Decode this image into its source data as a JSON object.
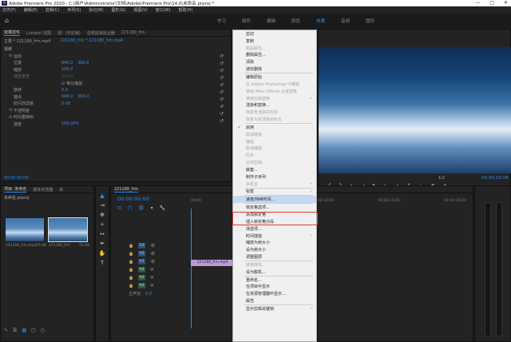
{
  "window": {
    "app_logo": "Pr",
    "title": "Adobe Premiere Pro 2020 - C:\\用户\\Administrator\\文档\\Adobe\\Premiere Pro\\14.0\\未命名.prproj *",
    "controls": [
      "—",
      "□",
      "✕"
    ]
  },
  "menubar": [
    "文件(F)",
    "编辑(E)",
    "剪辑(C)",
    "序列(S)",
    "标记(M)",
    "图形(G)",
    "视图(V)",
    "窗口(W)",
    "帮助(H)"
  ],
  "workspace_tabs": [
    {
      "label": "学习",
      "active": false
    },
    {
      "label": "组件",
      "active": false
    },
    {
      "label": "编辑",
      "active": false
    },
    {
      "label": "颜色",
      "active": false
    },
    {
      "label": "效果",
      "active": true
    },
    {
      "label": "音频",
      "active": false
    },
    {
      "label": "图形",
      "active": false
    }
  ],
  "effect_controls": {
    "tabs": [
      {
        "label": "效果控件",
        "active": true
      },
      {
        "label": "Lumetri 范围",
        "active": false
      },
      {
        "label": "源：(无剪辑)",
        "active": false
      },
      {
        "label": "音频剪辑混合器",
        "active": false
      },
      {
        "label": "221180_frin",
        "active": false
      }
    ],
    "source": "主要 * 221180_frin.mp4",
    "clip_ref": "221180_frin * 221180_frin.mp4",
    "section": "视频",
    "rows": [
      {
        "tri": "›",
        "fx": "fx",
        "name": "运动",
        "v1": "",
        "v2": ""
      },
      {
        "tri": "›",
        "fx": "",
        "name": "位置",
        "v1": "640.0",
        "v2": "360.0"
      },
      {
        "tri": "›",
        "fx": "",
        "name": "缩放",
        "v1": "100.0",
        "v2": ""
      },
      {
        "tri": "›",
        "fx": "",
        "name": "缩放宽度",
        "v1": "100.0",
        "v2": ""
      },
      {
        "tri": "",
        "fx": "",
        "name": "",
        "v1": "☑ 等比缩放",
        "v2": ""
      },
      {
        "tri": "›",
        "fx": "",
        "name": "旋转",
        "v1": "0.0",
        "v2": ""
      },
      {
        "tri": "",
        "fx": "",
        "name": "锚点",
        "v1": "640.0",
        "v2": "360.0"
      },
      {
        "tri": "›",
        "fx": "",
        "name": "防闪烁滤镜",
        "v1": "0.00",
        "v2": ""
      },
      {
        "tri": "›",
        "fx": "fx",
        "name": "不透明度",
        "v1": "",
        "v2": ""
      },
      {
        "tri": "›",
        "fx": "fx",
        "name": "时间重映射",
        "v1": "",
        "v2": ""
      },
      {
        "tri": "›",
        "fx": "",
        "name": "速度",
        "v1": "100.00%",
        "v2": ""
      }
    ],
    "timecode": "00:00:00:00"
  },
  "project_panel": {
    "tabs": [
      {
        "label": "项目: 未命名",
        "active": true
      },
      {
        "label": "媒体浏览器",
        "active": false
      },
      {
        "label": "库",
        "active": false
      }
    ],
    "path": "未命名.prproj",
    "items": [
      {
        "name": "221180_frin.mp4",
        "duration": "15:08"
      },
      {
        "name": "221180_frin",
        "duration": "15:08"
      }
    ]
  },
  "tools": [
    {
      "icon": "▲",
      "name": "selection-tool-icon",
      "active": true
    },
    {
      "icon": "⇥",
      "name": "track-select-icon",
      "active": false
    },
    {
      "icon": "✥",
      "name": "ripple-edit-icon",
      "active": false
    },
    {
      "icon": "⟡",
      "name": "razor-icon",
      "active": false
    },
    {
      "icon": "↔",
      "name": "slip-icon",
      "active": false
    },
    {
      "icon": "✒",
      "name": "pen-icon",
      "active": false
    },
    {
      "icon": "✋",
      "name": "hand-icon",
      "active": false
    },
    {
      "icon": "T",
      "name": "type-icon",
      "active": false
    }
  ],
  "timeline": {
    "tab": "221180_frin",
    "timecode": "00:00:00:00",
    "tracks_video": [
      "V3",
      "V2",
      "V1"
    ],
    "tracks_audio": [
      "A1",
      "A2",
      "A3"
    ],
    "master": "主声道",
    "master_value": "0.0",
    "clip_label": "221180_frin.mp4",
    "ruler": [
      "00:00",
      "00:00:05:00",
      "00:00:10:00",
      "00:00:15:00",
      "00:00:20:00"
    ]
  },
  "program_monitor": {
    "fraction": "1/2",
    "timecode": "00:00:15:08"
  },
  "context_menu": {
    "items": [
      {
        "label": "剪切",
        "disabled": false
      },
      {
        "label": "复制",
        "disabled": false
      },
      {
        "label": "粘贴属性...",
        "disabled": true
      },
      {
        "label": "删除属性...",
        "disabled": false
      },
      {
        "label": "清除",
        "disabled": false
      },
      {
        "label": "波纹删除",
        "disabled": false
      },
      {
        "sep": true
      },
      {
        "label": "编辑原始",
        "disabled": false
      },
      {
        "label": "在 Adobe Photoshop 中编辑",
        "disabled": true
      },
      {
        "label": "使用 After Effects 合成替换",
        "disabled": true
      },
      {
        "label": "使用剪辑替换",
        "disabled": true,
        "submenu": true
      },
      {
        "label": "渲染和替换...",
        "disabled": false
      },
      {
        "label": "恢复未渲染的内容",
        "disabled": true
      },
      {
        "label": "恢复为未渲染的时长",
        "disabled": true
      },
      {
        "sep": true
      },
      {
        "label": "启用",
        "disabled": false,
        "checked": true
      },
      {
        "label": "取消链接",
        "disabled": true
      },
      {
        "label": "编组",
        "disabled": true
      },
      {
        "label": "取消编组",
        "disabled": true
      },
      {
        "label": "同步",
        "disabled": true
      },
      {
        "label": "合并剪辑...",
        "disabled": true
      },
      {
        "label": "嵌套...",
        "disabled": false
      },
      {
        "label": "制作子序列",
        "disabled": false
      },
      {
        "label": "多机位",
        "disabled": true,
        "submenu": true
      },
      {
        "sep": true
      },
      {
        "label": "标签",
        "disabled": false,
        "submenu": true
      },
      {
        "sep": true
      },
      {
        "label": "速度/持续时间...",
        "disabled": false,
        "highlight": true
      },
      {
        "sep": true
      },
      {
        "label": "帧定格选项...",
        "disabled": false
      },
      {
        "label": "添加帧定格",
        "disabled": false
      },
      {
        "label": "插入帧定格分段",
        "disabled": false
      },
      {
        "label": "场选项...",
        "disabled": false
      },
      {
        "label": "时间插值",
        "disabled": false,
        "submenu": true
      },
      {
        "label": "缩放为帧大小",
        "disabled": false
      },
      {
        "label": "设为帧大小",
        "disabled": false
      },
      {
        "label": "调整图层",
        "disabled": false
      },
      {
        "sep": true
      },
      {
        "label": "链接媒体...",
        "disabled": true
      },
      {
        "label": "设为脱机...",
        "disabled": false
      },
      {
        "sep": true
      },
      {
        "label": "重命名...",
        "disabled": false
      },
      {
        "label": "在项目中显示",
        "disabled": false
      },
      {
        "label": "在资源管理器中显示...",
        "disabled": false
      },
      {
        "label": "属性",
        "disabled": false
      },
      {
        "sep": true
      },
      {
        "label": "显示剪辑关键帧",
        "disabled": false,
        "submenu": true
      }
    ]
  }
}
